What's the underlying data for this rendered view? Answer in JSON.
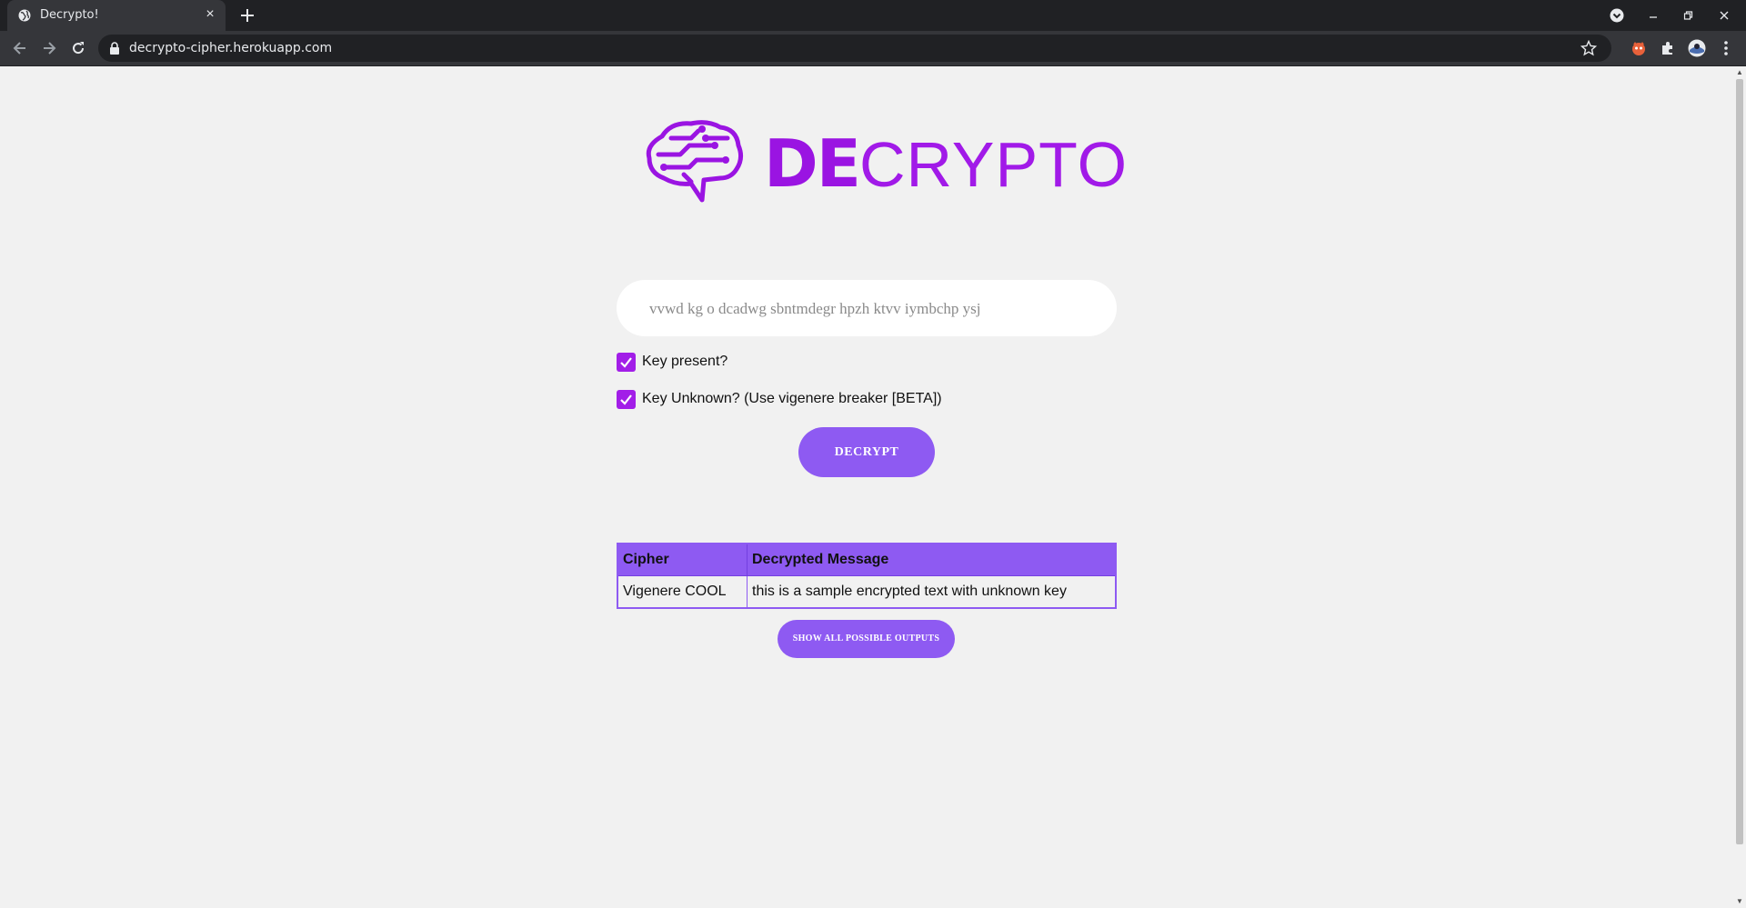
{
  "browser": {
    "tab_title": "Decrypto!",
    "tab_close": "×",
    "url": "decrypto-cipher.herokuapp.com"
  },
  "logo": {
    "bold_text": "DE",
    "light_text": "CRYPTO",
    "color": "#9a14e2"
  },
  "search": {
    "placeholder": "vvwd kg o dcadwg sbntmdegr hpzh ktvv iymbchp ysj"
  },
  "options": [
    {
      "label": "Key present?",
      "checked": true
    },
    {
      "label": "Key Unknown? (Use vigenere breaker [BETA])",
      "checked": true
    }
  ],
  "decrypt_label": "DECRYPT",
  "results": {
    "headers": [
      "Cipher",
      "Decrypted Message"
    ],
    "rows": [
      {
        "cipher": "Vigenere COOL",
        "message": "this is a sample encrypted text with unknown key"
      }
    ]
  },
  "show_all_label": "SHOW ALL POSSIBLE OUTPUTS",
  "colors": {
    "accent": "#8e5af2",
    "checkbox": "#a21ee8",
    "background": "#f1f1f1"
  }
}
